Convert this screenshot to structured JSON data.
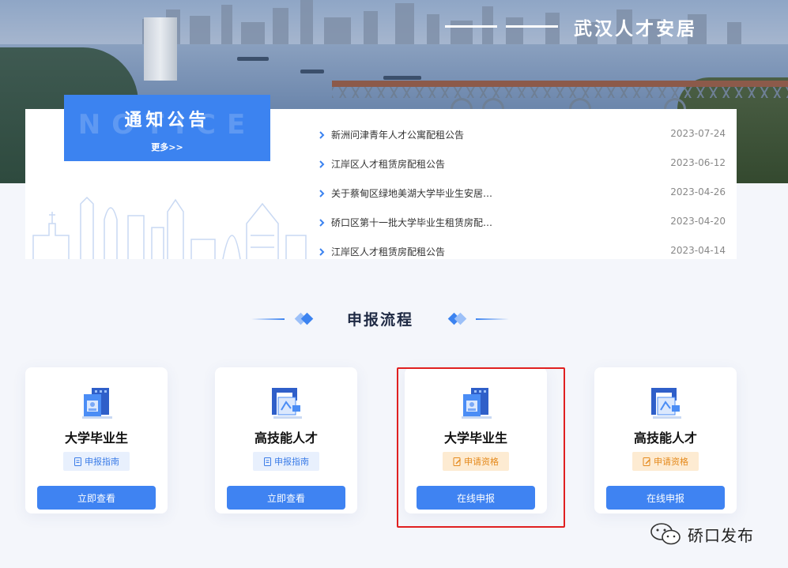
{
  "hero": {
    "title": "武汉人才安居"
  },
  "notice": {
    "watermark": "NOTICE",
    "title": "通知公告",
    "more": "更多>>",
    "items": [
      {
        "text": "新洲问津青年人才公寓配租公告",
        "date": "2023-07-24"
      },
      {
        "text": "江岸区人才租赁房配租公告",
        "date": "2023-06-12"
      },
      {
        "text": "关于蔡甸区绿地美湖大学毕业生安居…",
        "date": "2023-04-26"
      },
      {
        "text": "硚口区第十一批大学毕业生租赁房配…",
        "date": "2023-04-20"
      },
      {
        "text": "江岸区人才租赁房配租公告",
        "date": "2023-04-14"
      }
    ]
  },
  "process": {
    "title": "申报流程",
    "cards": [
      {
        "title": "大学毕业生",
        "badge": "申报指南",
        "button": "立即查看"
      },
      {
        "title": "高技能人才",
        "badge": "申报指南",
        "button": "立即查看"
      },
      {
        "title": "大学毕业生",
        "badge": "申请资格",
        "button": "在线申报"
      },
      {
        "title": "高技能人才",
        "badge": "申请资格",
        "button": "在线申报"
      }
    ]
  },
  "watermark": {
    "text": "硚口发布"
  },
  "colors": {
    "primary": "#3c83f0",
    "badge_orange": "#e58a1c",
    "highlight": "#e02020"
  }
}
